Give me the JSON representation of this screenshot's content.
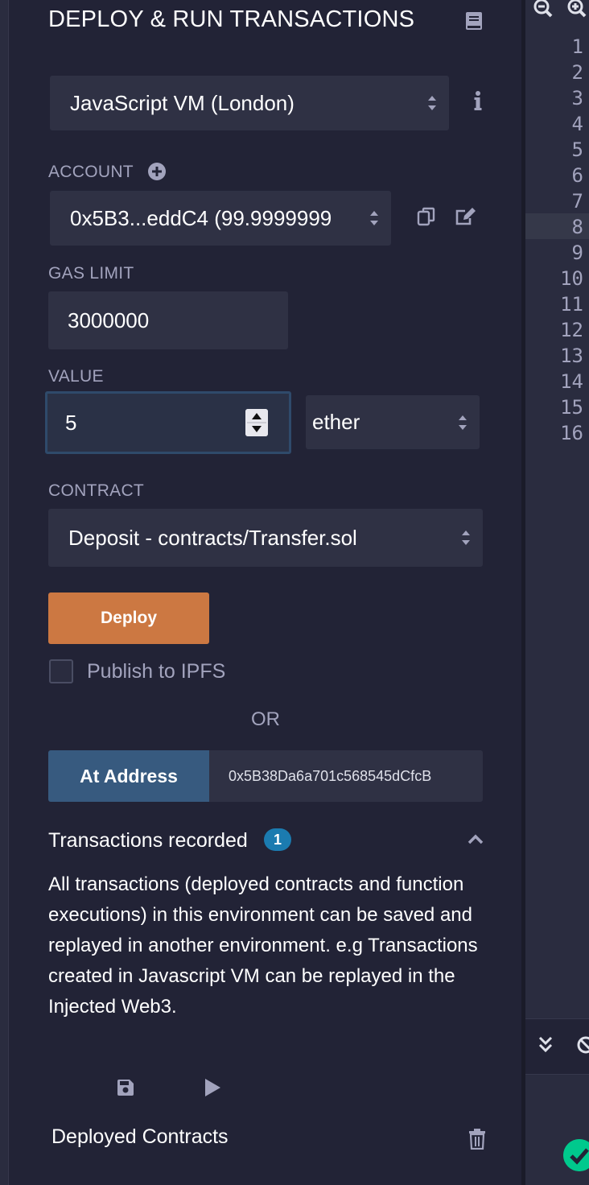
{
  "panel": {
    "title": "DEPLOY & RUN TRANSACTIONS",
    "environment": {
      "selected": "JavaScript VM (London)"
    },
    "account": {
      "label": "ACCOUNT",
      "selected": "0x5B3...eddC4 (99.9999999"
    },
    "gas_limit": {
      "label": "GAS LIMIT",
      "value": "3000000"
    },
    "value": {
      "label": "VALUE",
      "amount": "5",
      "unit": "ether"
    },
    "contract": {
      "label": "CONTRACT",
      "selected": "Deposit - contracts/Transfer.sol"
    },
    "deploy_label": "Deploy",
    "publish_label": "Publish to IPFS",
    "or_label": "OR",
    "at_address": {
      "button_label": "At Address",
      "value": "0x5B38Da6a701c568545dCfcB"
    },
    "transactions": {
      "title": "Transactions recorded",
      "count": "1",
      "description": "All transactions (deployed contracts and function executions) in this environment can be saved and replayed in another environment. e.g Transactions created in Javascript VM can be replayed in the Injected Web3."
    },
    "deployed_title": "Deployed Contracts"
  },
  "editor": {
    "line_numbers": [
      "1",
      "2",
      "3",
      "4",
      "5",
      "6",
      "7",
      "8",
      "9",
      "10",
      "11",
      "12",
      "13",
      "14",
      "15",
      "16"
    ],
    "highlighted_line": "8"
  },
  "colors": {
    "background": "#222336",
    "input_bg": "#2f3144",
    "deploy": "#cc7842",
    "at_address": "#375a7f",
    "badge": "#1b7bb0",
    "success": "#00c98d"
  }
}
